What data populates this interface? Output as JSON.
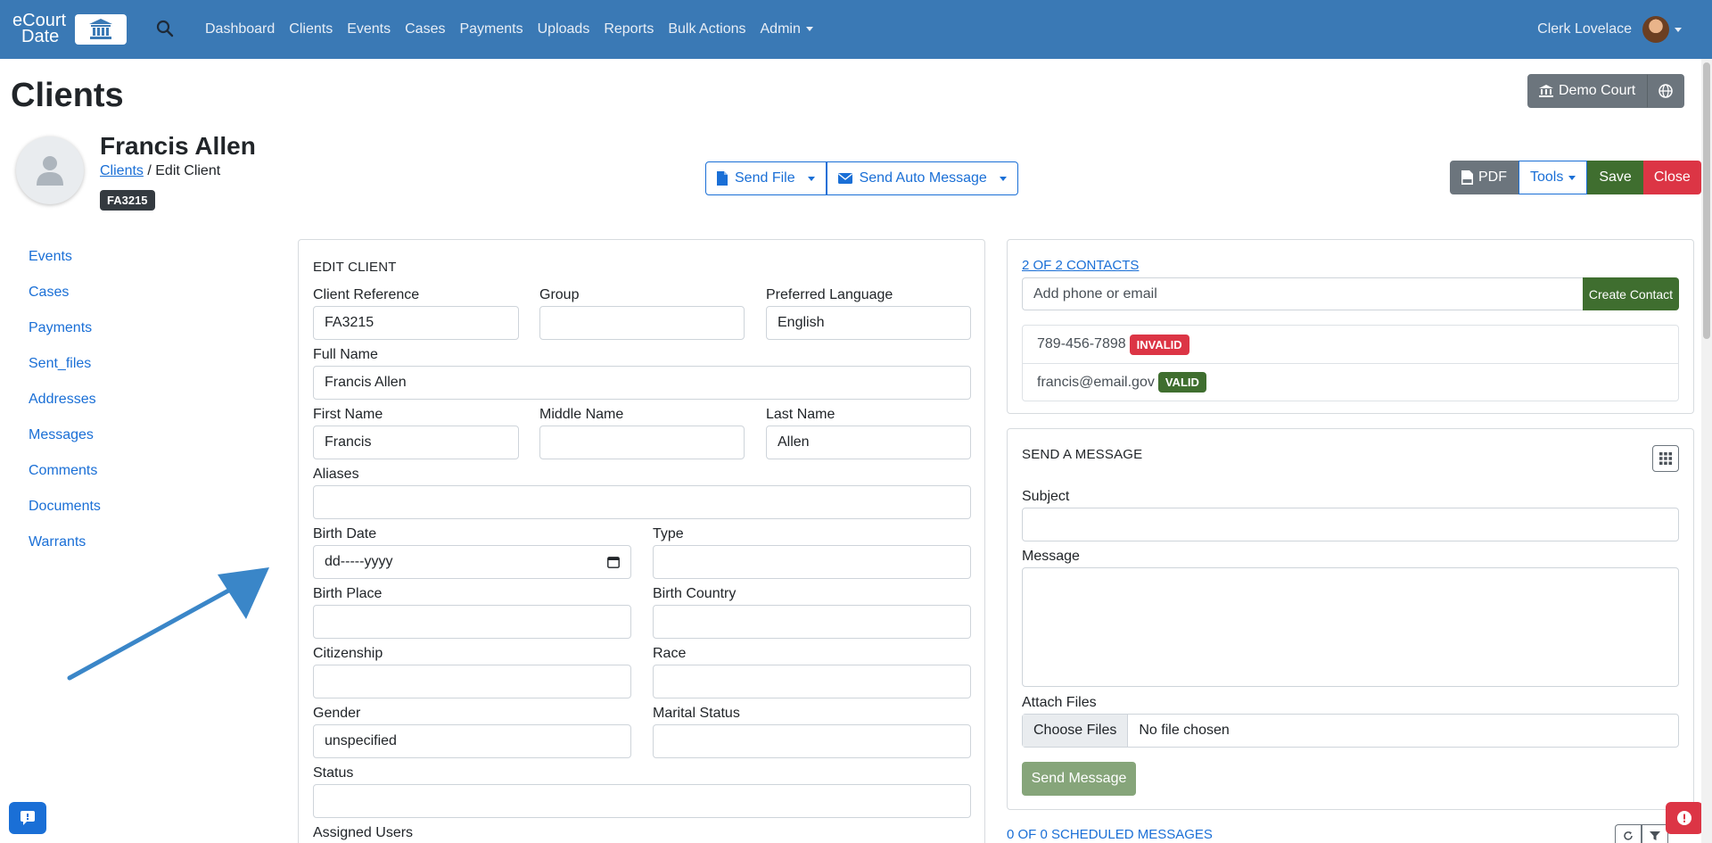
{
  "navbar": {
    "brand_line1": "eCourt",
    "brand_line2": "Date",
    "links": [
      "Dashboard",
      "Clients",
      "Events",
      "Cases",
      "Payments",
      "Uploads",
      "Reports",
      "Bulk Actions",
      "Admin"
    ],
    "user_name": "Clerk Lovelace"
  },
  "page": {
    "title": "Clients",
    "court_label": "Demo Court"
  },
  "client": {
    "name": "Francis Allen",
    "breadcrumb_link": "Clients",
    "breadcrumb_current": " / Edit Client",
    "reference_badge": "FA3215"
  },
  "actions": {
    "send_file": "Send File",
    "send_auto_message": "Send Auto Message",
    "pdf": "PDF",
    "tools": "Tools",
    "save": "Save",
    "close": "Close"
  },
  "sidebar": {
    "items": [
      "Events",
      "Cases",
      "Payments",
      "Sent_files",
      "Addresses",
      "Messages",
      "Comments",
      "Documents",
      "Warrants"
    ]
  },
  "edit_client": {
    "title": "EDIT CLIENT",
    "fields": {
      "client_reference": {
        "label": "Client Reference",
        "value": "FA3215"
      },
      "group": {
        "label": "Group",
        "value": ""
      },
      "preferred_language": {
        "label": "Preferred Language",
        "value": "English"
      },
      "full_name": {
        "label": "Full Name",
        "value": "Francis Allen"
      },
      "first_name": {
        "label": "First Name",
        "value": "Francis"
      },
      "middle_name": {
        "label": "Middle Name",
        "value": ""
      },
      "last_name": {
        "label": "Last Name",
        "value": "Allen"
      },
      "aliases": {
        "label": "Aliases",
        "value": ""
      },
      "birth_date": {
        "label": "Birth Date",
        "value": "dd-----yyyy"
      },
      "type": {
        "label": "Type",
        "value": ""
      },
      "birth_place": {
        "label": "Birth Place",
        "value": ""
      },
      "birth_country": {
        "label": "Birth Country",
        "value": ""
      },
      "citizenship": {
        "label": "Citizenship",
        "value": ""
      },
      "race": {
        "label": "Race",
        "value": ""
      },
      "gender": {
        "label": "Gender",
        "value": "unspecified"
      },
      "marital_status": {
        "label": "Marital Status",
        "value": ""
      },
      "status": {
        "label": "Status",
        "value": ""
      },
      "assigned_users": {
        "label": "Assigned Users",
        "value": ""
      }
    }
  },
  "contacts": {
    "header_link": "2 OF 2 CONTACTS",
    "input_placeholder": "Add phone or email",
    "create_button": "Create Contact",
    "items": [
      {
        "value": "789-456-7898",
        "badge": "INVALID"
      },
      {
        "value": "francis@email.gov",
        "badge": "VALID"
      }
    ]
  },
  "message": {
    "title": "SEND A MESSAGE",
    "subject_label": "Subject",
    "message_label": "Message",
    "attach_label": "Attach Files",
    "choose_files": "Choose Files",
    "no_file": "No file chosen",
    "send_button": "Send Message"
  },
  "scheduled": {
    "link": "0 OF 0 SCHEDULED MESSAGES"
  },
  "colors": {
    "navbar": "#3a79b5",
    "link": "#1a6fd6",
    "success": "#3f6e2f",
    "danger": "#dc3545",
    "secondary": "#6c757d"
  }
}
